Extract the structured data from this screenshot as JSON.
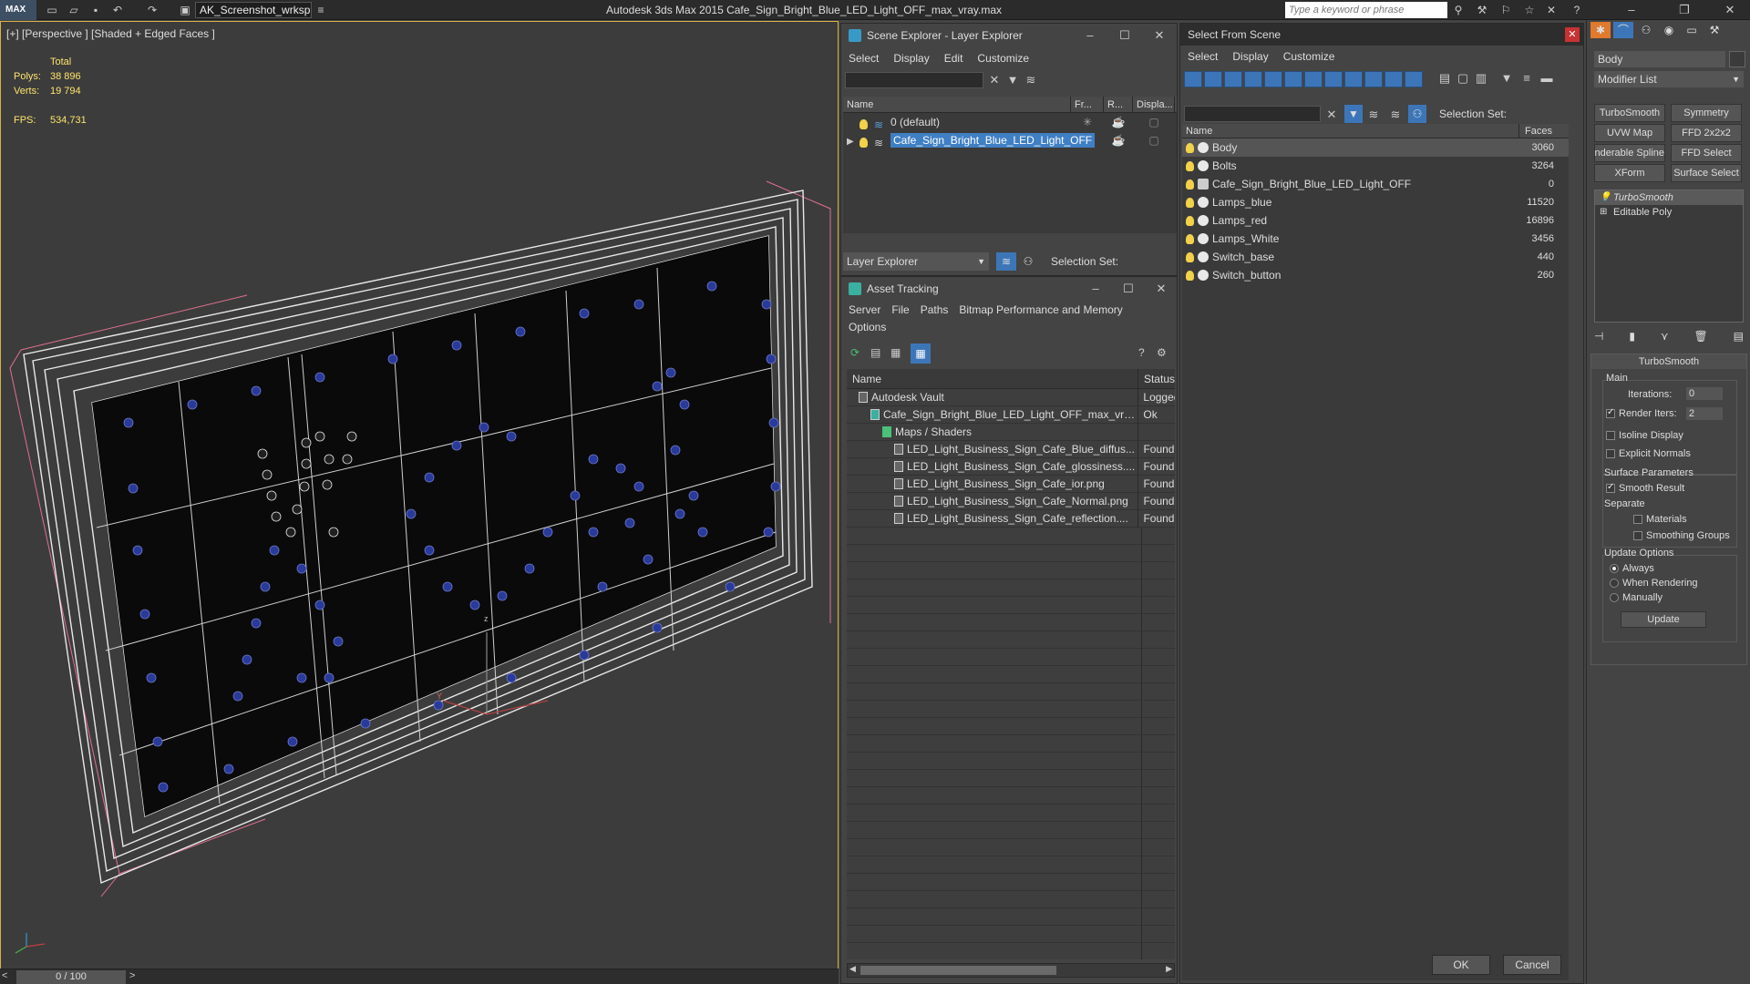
{
  "titlebar": {
    "logo": "MAX",
    "workspace": "AK_Screenshot_wrksp",
    "app_title": "Autodesk 3ds Max  2015    Cafe_Sign_Bright_Blue_LED_Light_OFF_max_vray.max",
    "search_placeholder": "Type a keyword or phrase"
  },
  "viewport": {
    "label": "[+] [Perspective ] [Shaded + Edged Faces ]",
    "stats_header": "Total",
    "polys_label": "Polys:",
    "polys_value": "38 896",
    "verts_label": "Verts:",
    "verts_value": "19 794",
    "fps_label": "FPS:",
    "fps_value": "534,731",
    "axis_z": "z",
    "axis_y": "Y"
  },
  "timeline": {
    "frame": "0 / 100",
    "prev": "<",
    "next": ">"
  },
  "scene_explorer": {
    "title": "Scene Explorer - Layer Explorer",
    "menu": [
      "Select",
      "Display",
      "Edit",
      "Customize"
    ],
    "columns": [
      "Name",
      "Fr...",
      "R...",
      "Displa..."
    ],
    "rows": [
      {
        "name": "0 (default)",
        "selected": false
      },
      {
        "name": "Cafe_Sign_Bright_Blue_LED_Light_OFF",
        "selected": true
      }
    ],
    "footer_dropdown": "Layer Explorer",
    "selection_set": "Selection Set:"
  },
  "asset_tracking": {
    "title": "Asset Tracking",
    "menu": [
      "Server",
      "File",
      "Paths",
      "Bitmap Performance and Memory"
    ],
    "menu2": "Options",
    "columns": [
      "Name",
      "Status"
    ],
    "rows": [
      {
        "name": "Autodesk Vault",
        "status": "Logged",
        "indent": 1
      },
      {
        "name": "Cafe_Sign_Bright_Blue_LED_Light_OFF_max_vra...",
        "status": "Ok",
        "indent": 2
      },
      {
        "name": "Maps / Shaders",
        "status": "",
        "indent": 3
      },
      {
        "name": "LED_Light_Business_Sign_Cafe_Blue_diffus...",
        "status": "Found",
        "indent": 4
      },
      {
        "name": "LED_Light_Business_Sign_Cafe_glossiness....",
        "status": "Found",
        "indent": 4
      },
      {
        "name": "LED_Light_Business_Sign_Cafe_ior.png",
        "status": "Found",
        "indent": 4
      },
      {
        "name": "LED_Light_Business_Sign_Cafe_Normal.png",
        "status": "Found",
        "indent": 4
      },
      {
        "name": "LED_Light_Business_Sign_Cafe_reflection....",
        "status": "Found",
        "indent": 4
      }
    ]
  },
  "select_from_scene": {
    "title": "Select From Scene",
    "menu": [
      "Select",
      "Display",
      "Customize"
    ],
    "selection_set": "Selection Set:",
    "columns": [
      "Name",
      "Faces"
    ],
    "rows": [
      {
        "name": "Body",
        "faces": "3060",
        "selected": true
      },
      {
        "name": "Bolts",
        "faces": "3264",
        "selected": false
      },
      {
        "name": "Cafe_Sign_Bright_Blue_LED_Light_OFF",
        "faces": "0",
        "selected": false
      },
      {
        "name": "Lamps_blue",
        "faces": "11520",
        "selected": false
      },
      {
        "name": "Lamps_red",
        "faces": "16896",
        "selected": false
      },
      {
        "name": "Lamps_White",
        "faces": "3456",
        "selected": false
      },
      {
        "name": "Switch_base",
        "faces": "440",
        "selected": false
      },
      {
        "name": "Switch_button",
        "faces": "260",
        "selected": false
      }
    ],
    "ok": "OK",
    "cancel": "Cancel"
  },
  "command_panel": {
    "object_name": "Body",
    "modifier_list": "Modifier List",
    "buttons": [
      "TurboSmooth",
      "Symmetry",
      "UVW Map",
      "FFD 2x2x2",
      "Renderable Spline",
      "FFD Select",
      "XForm",
      "Surface Select"
    ],
    "stack": [
      "TurboSmooth",
      "Editable Poly"
    ],
    "rollout_title": "TurboSmooth",
    "main": "Main",
    "iterations_label": "Iterations:",
    "iterations_value": "0",
    "render_iters_label": "Render Iters:",
    "render_iters_value": "2",
    "isoline": "Isoline Display",
    "explicit": "Explicit Normals",
    "surface_params": "Surface Parameters",
    "smooth_result": "Smooth Result",
    "separate": "Separate",
    "materials": "Materials",
    "smoothing_groups": "Smoothing Groups",
    "update_options": "Update Options",
    "always": "Always",
    "when_rendering": "When Rendering",
    "manually": "Manually",
    "update": "Update"
  }
}
